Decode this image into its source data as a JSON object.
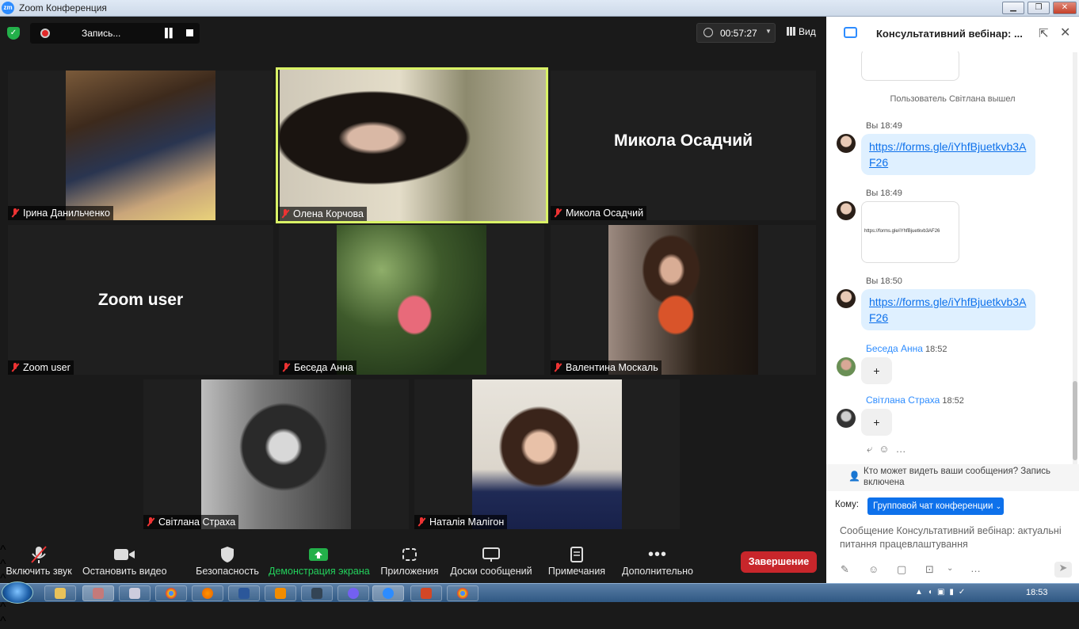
{
  "window": {
    "title": "Zoom Конференция",
    "logo": "zm"
  },
  "recording": {
    "label": "Запись..."
  },
  "timer": {
    "value": "00:57:27"
  },
  "view": {
    "label": "Вид"
  },
  "participants": [
    {
      "name": "Ірина  Данильченко",
      "video": true,
      "active": false
    },
    {
      "name": "Олена Корчова",
      "video": true,
      "active": true
    },
    {
      "name": "Микола Осадчий",
      "video": false,
      "active": false
    },
    {
      "name": "Zoom user",
      "video": false,
      "active": false
    },
    {
      "name": "Беседа Анна",
      "video": true,
      "active": false
    },
    {
      "name": "Валентина Москаль",
      "video": true,
      "active": false
    },
    {
      "name": "Світлана Страха",
      "video": true,
      "active": false
    },
    {
      "name": "Наталія Малігон",
      "video": true,
      "active": false
    }
  ],
  "toolbar": {
    "mute": "Включить звук",
    "video": "Остановить видео",
    "security": "Безопасность",
    "share": "Демонстрация экрана",
    "apps": "Приложения",
    "whiteboards": "Доски сообщений",
    "notes": "Примечания",
    "more": "Дополнительно",
    "end": "Завершение"
  },
  "chat": {
    "title": "Консультативний вебінар: ...",
    "system_message": "Пользователь Світлана вышел",
    "messages": [
      {
        "meta": "Вы 18:49",
        "link": "https://forms.gle/iYhfBjuetkvb3AF26"
      },
      {
        "meta": "Вы 18:49",
        "image_text": "https://forms.gle/iYhfBjuetkvb3AF26"
      },
      {
        "meta": "Вы 18:50",
        "link": "https://forms.gle/iYhfBjuetkvb3AF26"
      },
      {
        "sender": "Беседа Анна",
        "time": "18:52",
        "text": "+"
      },
      {
        "sender": "Світлана Страха",
        "time": "18:52",
        "text": "+"
      }
    ],
    "who_can_see": "Кто может видеть ваши сообщения? Запись включена",
    "to_label": "Кому:",
    "to_value": "Групповой чат конференции",
    "placeholder": "Сообщение Консультативний вебінар: актуальні питання працевлаштування"
  },
  "taskbar": {
    "clock": "18:53"
  },
  "colors": {
    "accent": "#2d8cff",
    "active_border": "#d9f266",
    "end": "#c8262b",
    "share": "#23b04a"
  }
}
